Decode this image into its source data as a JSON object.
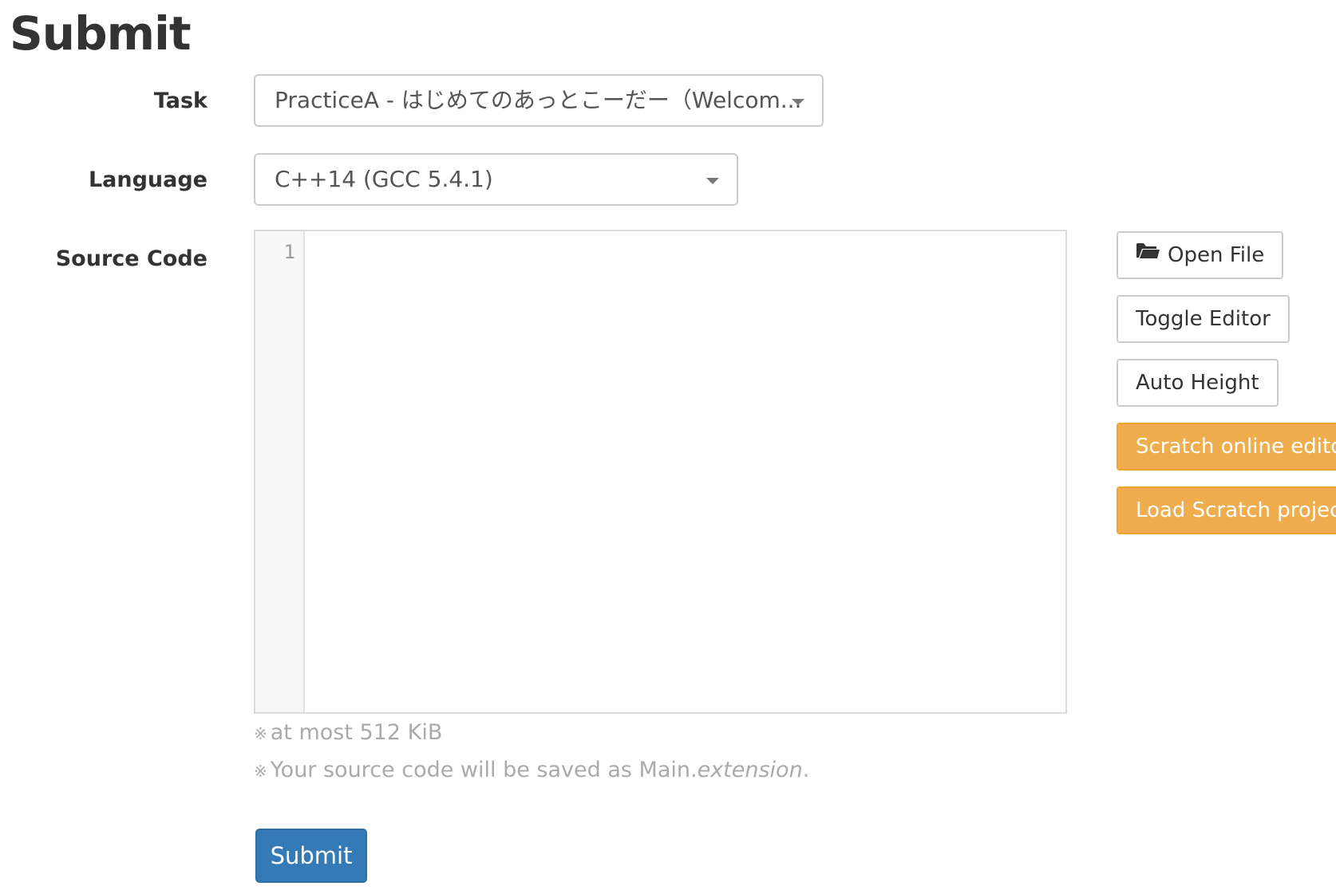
{
  "page": {
    "title": "Submit"
  },
  "form": {
    "task": {
      "label": "Task",
      "selected": "PracticeA - はじめてのあっとこーだー（Welcom..."
    },
    "language": {
      "label": "Language",
      "selected": "C++14 (GCC 5.4.1)"
    },
    "source_code": {
      "label": "Source Code",
      "line_numbers": [
        "1"
      ],
      "value": ""
    },
    "notes": {
      "mark": "※",
      "size_limit": "at most 512 KiB",
      "save_prefix": "Your source code will be saved as Main.",
      "save_ext": "extension",
      "save_suffix": "."
    },
    "submit_label": "Submit"
  },
  "side_buttons": {
    "open_file": {
      "label": "Open File",
      "icon": "folder-open-icon"
    },
    "toggle_editor": {
      "label": "Toggle Editor"
    },
    "auto_height": {
      "label": "Auto Height"
    },
    "scratch_editor": {
      "label": "Scratch online editor"
    },
    "load_scratch": {
      "label": "Load Scratch project"
    }
  },
  "colors": {
    "primary": "#337ab7",
    "warning": "#f0ad4e",
    "muted_text": "#aaaaaa",
    "border": "#cccccc"
  }
}
